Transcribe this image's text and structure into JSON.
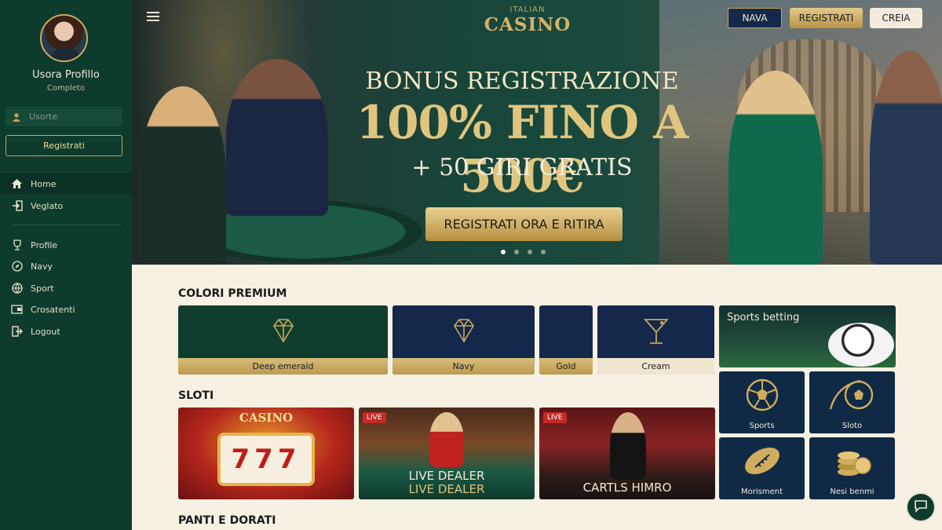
{
  "sidebar": {
    "user_name": "Usora Profillo",
    "user_status": "Completo",
    "username_placeholder": "Usorte",
    "register_label": "Registrati",
    "nav_main": [
      {
        "label": "Home",
        "icon": "home-icon"
      },
      {
        "label": "Veglato",
        "icon": "login-icon"
      }
    ],
    "nav_secondary": [
      {
        "label": "Profile",
        "icon": "trophy-icon"
      },
      {
        "label": "Navy",
        "icon": "compass-icon"
      },
      {
        "label": "Sport",
        "icon": "ball-icon"
      },
      {
        "label": "Crosatenti",
        "icon": "wallet-icon"
      },
      {
        "label": "Logout",
        "icon": "logout-icon"
      }
    ]
  },
  "header": {
    "logo_top": "ITALIAN",
    "logo_main": "CASINO",
    "buttons": [
      "NAVA",
      "REGISTRATI",
      "CREIA"
    ]
  },
  "hero": {
    "line1": "BONUS REGISTRAZIONE",
    "line2": "100% FINO A 500€",
    "line3": "+ 50 GIRI GRATIS",
    "cta": "REGISTRATI ORA E RITIRA",
    "slides": 4,
    "active_slide": 1
  },
  "colors_section": {
    "title": "COLORI PREMIUM",
    "tiles": [
      {
        "label": "Deep emerald",
        "bg": "#0f3e2e",
        "icon": "diamond-icon"
      },
      {
        "label": "Navy",
        "bg": "#13284a",
        "icon": "diamond-icon"
      },
      {
        "label": "Gold",
        "bg": "#13284a",
        "icon": ""
      },
      {
        "label": "Cream",
        "bg": "#13284a",
        "icon": "cocktail-icon"
      }
    ]
  },
  "slots_section": {
    "title": "SLOTI",
    "games": [
      {
        "live": "",
        "caption": "",
        "logo": "CASINO",
        "sub": "777"
      },
      {
        "live": "LIVE",
        "caption": "LIVE DEALER",
        "caption2": "LIVE DEALER"
      },
      {
        "live": "LIVE",
        "caption": "CARTLS HIMRO",
        "caption2": ""
      }
    ]
  },
  "sports": {
    "big_title": "Sports betting",
    "tiles": [
      {
        "label": "Sports",
        "icon": "soccer-ball-icon"
      },
      {
        "label": "Sloto",
        "icon": "soccer-ball-icon"
      },
      {
        "label": "Morisment",
        "icon": "football-icon"
      },
      {
        "label": "Nesi benmi",
        "icon": "coins-icon"
      }
    ]
  },
  "bottom_section": {
    "title": "PANTI E DORATI"
  },
  "colors": {
    "sidebar": "#0d3b2c",
    "gold": "#c9a75a",
    "cream": "#f6f1e3",
    "navy": "#13284a",
    "live_red": "#c52a26"
  }
}
